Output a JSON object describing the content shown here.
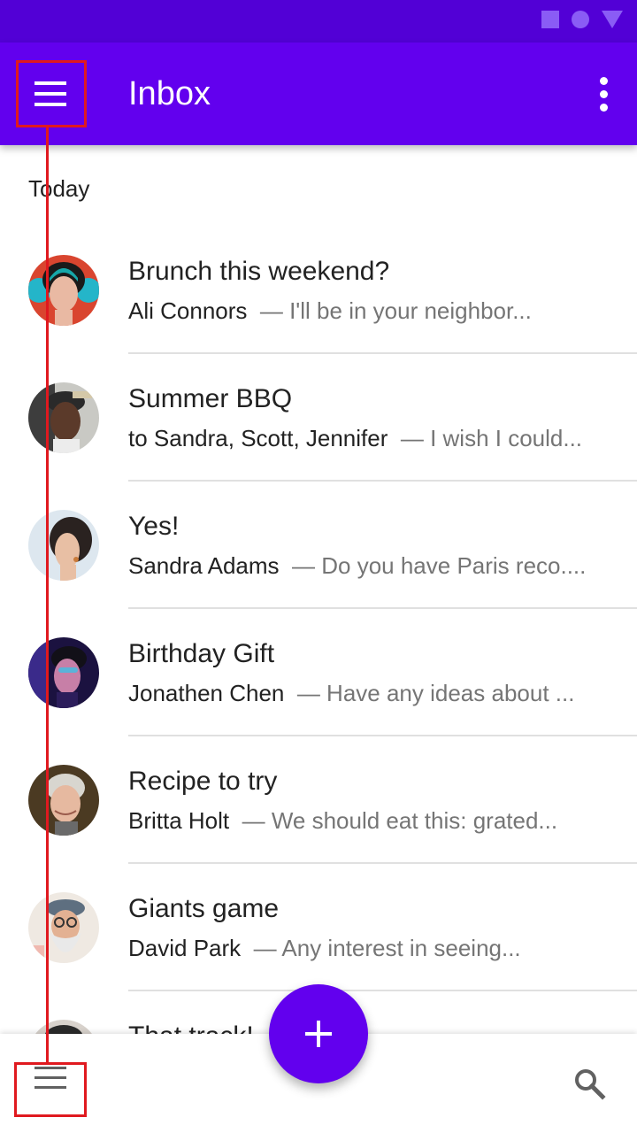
{
  "app_bar": {
    "title": "Inbox",
    "menu_icon": "menu-icon",
    "more_icon": "more-vert-icon",
    "background": "#6200ee"
  },
  "status_bar": {
    "background": "#5200d6",
    "icons": [
      "square-icon",
      "circle-icon",
      "triangle-icon"
    ]
  },
  "section": {
    "header": "Today"
  },
  "messages": [
    {
      "title": "Brunch this weekend?",
      "sender": "Ali Connors",
      "snippet": "— I'll be in your neighbor..."
    },
    {
      "title": "Summer BBQ",
      "sender": "to Sandra, Scott, Jennifer",
      "snippet": "— I wish I could..."
    },
    {
      "title": "Yes!",
      "sender": "Sandra Adams",
      "snippet": "— Do you have Paris reco...."
    },
    {
      "title": "Birthday Gift",
      "sender": "Jonathen Chen",
      "snippet": "— Have any ideas about ..."
    },
    {
      "title": "Recipe to try",
      "sender": "Britta Holt",
      "snippet": "— We should eat this: grated..."
    },
    {
      "title": "Giants game",
      "sender": "David Park",
      "snippet": "— Any interest in seeing..."
    },
    {
      "title": "That track!",
      "sender": "",
      "snippet": ""
    }
  ],
  "bottom_bar": {
    "menu_icon": "menu-icon",
    "search_icon": "search-icon"
  },
  "fab": {
    "icon": "add-icon",
    "color": "#6200ee"
  },
  "annotation": {
    "color": "#e0191f"
  }
}
